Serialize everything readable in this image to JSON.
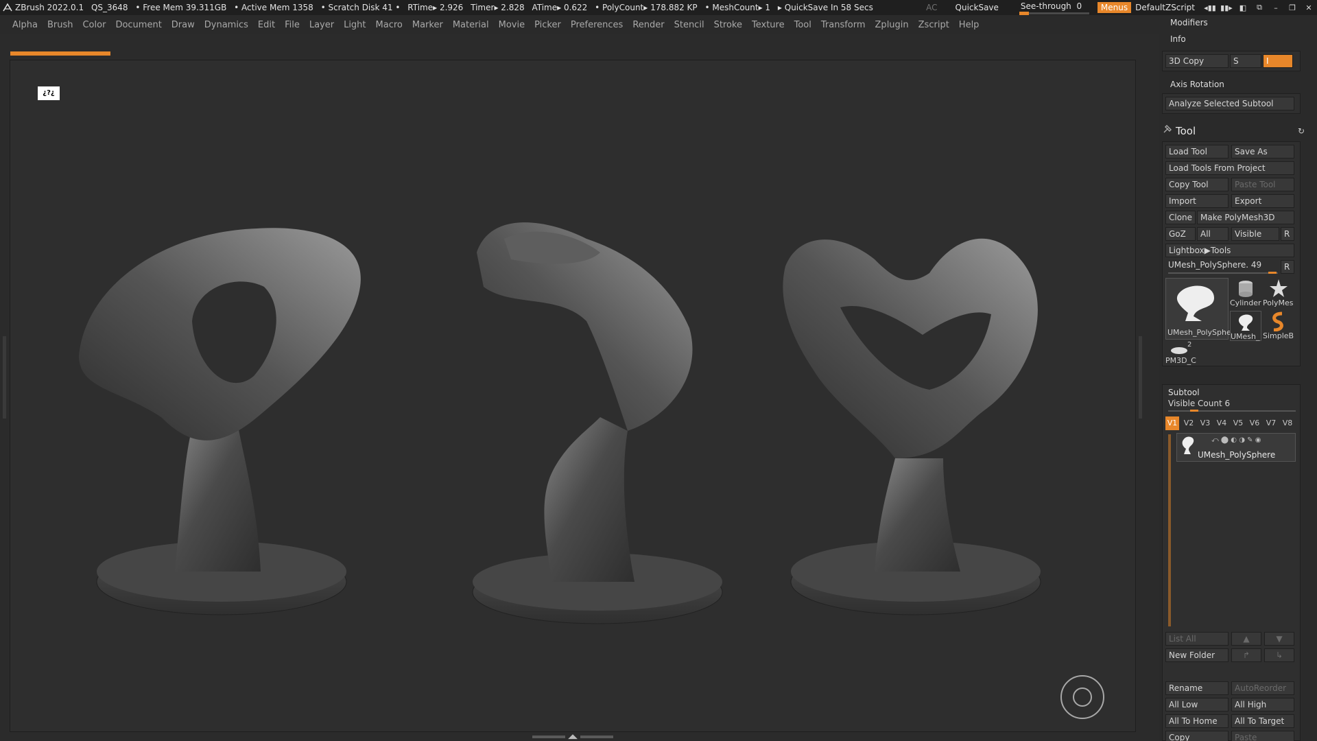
{
  "titlebar": {
    "app": "ZBrush 2022.0.1",
    "project": "QS_3648",
    "free_mem": "• Free Mem 39.311GB",
    "active_mem": "• Active Mem 1358",
    "scratch": "• Scratch Disk 41 •",
    "rtime": "RTime▸ 2.926",
    "timer": "Timer▸ 2.828",
    "atime": "ATime▸ 0.622",
    "polycount": "• PolyCount▸ 178.882 KP",
    "meshcount": "• MeshCount▸ 1",
    "quicksave_in": "▸ QuickSave In 58 Secs",
    "ac": "AC",
    "quicksave": "QuickSave",
    "see_through": "See-through",
    "see_through_value": "0",
    "menus": "Menus",
    "default_zscript": "DefaultZScript"
  },
  "menubar": [
    "Alpha",
    "Brush",
    "Color",
    "Document",
    "Draw",
    "Dynamics",
    "Edit",
    "File",
    "Layer",
    "Light",
    "Macro",
    "Marker",
    "Material",
    "Movie",
    "Picker",
    "Preferences",
    "Render",
    "Stencil",
    "Stroke",
    "Texture",
    "Tool",
    "Transform",
    "Zplugin",
    "Zscript",
    "Help"
  ],
  "canvas": {
    "marker_text": "¿?¿"
  },
  "right_panel": {
    "modifiers": "Modifiers",
    "info": "Info",
    "copy3d": "3D Copy",
    "copy3d_s": "S",
    "copy3d_i": "I",
    "axis_rotation": "Axis Rotation",
    "analyze": "Analyze Selected Subtool",
    "tool": {
      "title": "Tool",
      "load_tool": "Load Tool",
      "save_as": "Save As",
      "load_from_project": "Load Tools From Project",
      "copy_tool": "Copy Tool",
      "paste_tool": "Paste Tool",
      "import": "Import",
      "export": "Export",
      "clone": "Clone",
      "make_polymesh": "Make PolyMesh3D",
      "goz": "GoZ",
      "all": "All",
      "visible": "Visible",
      "r": "R",
      "lightbox": "Lightbox▶Tools",
      "current_tool": "UMesh_PolySphere. 49",
      "current_r": "R",
      "thumbs": [
        {
          "label": "UMesh_PolySphe",
          "icon": "umesh-large-icon"
        },
        {
          "label": "Cylinder",
          "icon": "cylinder-icon"
        },
        {
          "label": "PolyMes",
          "icon": "polymesh-star-icon"
        },
        {
          "label": "UMesh_",
          "icon": "umesh-small-icon"
        },
        {
          "label": "SimpleB",
          "icon": "simplebrush-icon"
        },
        {
          "label": "PM3D_C",
          "icon": "pm3d-icon"
        }
      ],
      "pm3d_count": "2"
    },
    "subtool": {
      "title": "Subtool",
      "visible_count": "Visible Count 6",
      "tabs": [
        "V1",
        "V2",
        "V3",
        "V4",
        "V5",
        "V6",
        "V7",
        "V8"
      ],
      "active_tab": "V1",
      "item_name": "UMesh_PolySphere",
      "list_all": "List All",
      "new_folder": "New Folder",
      "rename": "Rename",
      "auto_reorder": "AutoReorder",
      "all_low": "All Low",
      "all_high": "All High",
      "all_to_home": "All To Home",
      "all_to_target": "All To Target",
      "copy": "Copy",
      "paste": "Paste"
    }
  },
  "colors": {
    "accent": "#e8872a",
    "background": "#2e2e2e",
    "panel": "#2a2a2a"
  }
}
